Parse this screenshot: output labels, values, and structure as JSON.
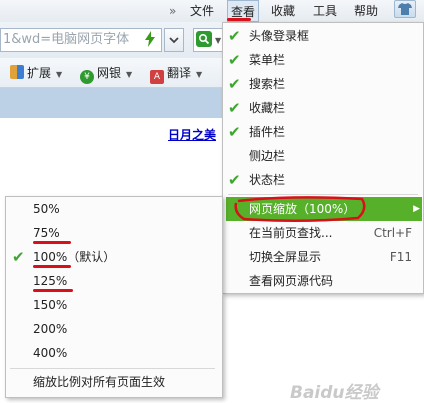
{
  "menubar": {
    "overflow_chevron": "»",
    "items": [
      {
        "label": "文件"
      },
      {
        "label": "查看"
      },
      {
        "label": "收藏"
      },
      {
        "label": "工具"
      },
      {
        "label": "帮助"
      }
    ],
    "skin_icon": "tshirt-icon"
  },
  "address": {
    "url_text": "1&wd=电脑网页字体",
    "security_icon": "lightning-icon",
    "dropdown_icon": "chevron-down-icon",
    "search_icon": "search-engine-icon"
  },
  "toolbar": {
    "items": [
      {
        "label": "扩展",
        "icon": "extensions-icon",
        "color": "#3c7fd1"
      },
      {
        "label": "网银",
        "icon": "netbank-icon",
        "color": "#2f9a2f"
      },
      {
        "label": "翻译",
        "icon": "translate-icon",
        "color": "#d04040"
      }
    ]
  },
  "page": {
    "link_text": "日月之美"
  },
  "view_menu": {
    "items": [
      {
        "label": "头像登录框",
        "checked": true
      },
      {
        "label": "菜单栏",
        "checked": true
      },
      {
        "label": "搜索栏",
        "checked": true
      },
      {
        "label": "收藏栏",
        "checked": true
      },
      {
        "label": "插件栏",
        "checked": true
      },
      {
        "label": "侧边栏",
        "checked": false
      },
      {
        "label": "状态栏",
        "checked": true
      }
    ],
    "zoom_item": {
      "label": "网页缩放（100%）"
    },
    "find_item": {
      "label": "在当前页查找...",
      "shortcut": "Ctrl+F"
    },
    "fullscreen_item": {
      "label": "切换全屏显示",
      "shortcut": "F11"
    },
    "source_item": {
      "label": "查看网页源代码"
    }
  },
  "zoom_submenu": {
    "items": [
      {
        "label": "50%",
        "checked": false
      },
      {
        "label": "75%",
        "checked": false
      },
      {
        "label": "100%（默认）",
        "checked": true
      },
      {
        "label": "125%",
        "checked": false
      },
      {
        "label": "150%",
        "checked": false
      },
      {
        "label": "200%",
        "checked": false
      },
      {
        "label": "400%",
        "checked": false
      }
    ],
    "apply_all": "缩放比例对所有页面生效"
  },
  "watermark": "Baidu经验",
  "colors": {
    "accent_green": "#57b02a",
    "check_green": "#3da630",
    "annotation_red": "#d8101a",
    "link_blue": "#0000cc"
  }
}
